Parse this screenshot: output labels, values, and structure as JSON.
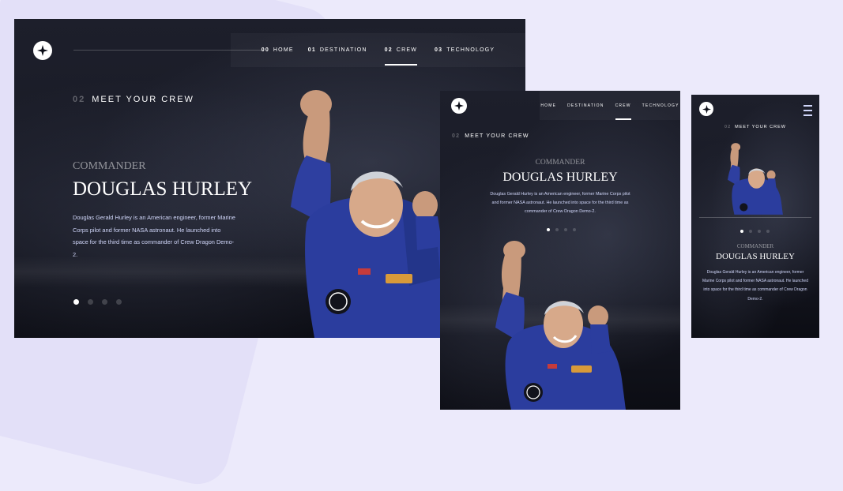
{
  "brand": {
    "logo_icon": "star-compass-icon"
  },
  "nav": [
    {
      "num": "00",
      "label": "HOME"
    },
    {
      "num": "01",
      "label": "DESTINATION"
    },
    {
      "num": "02",
      "label": "CREW"
    },
    {
      "num": "03",
      "label": "TECHNOLOGY"
    }
  ],
  "tablet_nav": [
    "HOME",
    "DESTINATION",
    "CREW",
    "TECHNOLOGY"
  ],
  "section": {
    "num": "02",
    "title": "MEET YOUR CREW"
  },
  "crew": {
    "role": "COMMANDER",
    "name": "DOUGLAS HURLEY",
    "bio": "Douglas Gerald Hurley is an American engineer, former Marine Corps pilot and former NASA astronaut. He launched into space for the third time as commander of Crew Dragon Demo-2."
  },
  "slider": {
    "count": 4,
    "active_index": 0
  },
  "mobile": {
    "menu_icon": "hamburger-menu-icon"
  },
  "colors": {
    "accent": "#FFFFFF",
    "muted": "#D0D6F9",
    "background": "#ECEAFB",
    "frame_dark": "#181A25"
  }
}
